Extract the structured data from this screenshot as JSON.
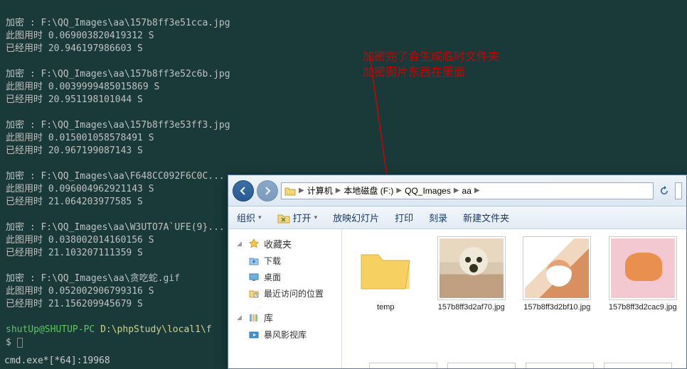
{
  "terminal": {
    "blocks": [
      {
        "encrypt": "加密 : F:\\QQ_Images\\aa\\157b8ff3e51cca.jpg",
        "img_time": "此图用时 0.069003820419312 S",
        "elapsed": "已经用时 20.946197986603 S"
      },
      {
        "encrypt": "加密 : F:\\QQ_Images\\aa\\157b8ff3e52c6b.jpg",
        "img_time": "此图用时 0.0039999485015869 S",
        "elapsed": "已经用时 20.951198101044 S"
      },
      {
        "encrypt": "加密 : F:\\QQ_Images\\aa\\157b8ff3e53ff3.jpg",
        "img_time": "此图用时 0.015001058578491 S",
        "elapsed": "已经用时 20.967199087143 S"
      },
      {
        "encrypt": "加密 : F:\\QQ_Images\\aa\\F648CC092F6C0C...",
        "img_time": "此图用时 0.096004962921143 S",
        "elapsed": "已经用时 21.064203977585 S"
      },
      {
        "encrypt": "加密 : F:\\QQ_Images\\aa\\W3UTO7A`UFE(9}...",
        "img_time": "此图用时 0.038002014160156 S",
        "elapsed": "已经用时 21.103207111359 S"
      },
      {
        "encrypt": "加密 : F:\\QQ_Images\\aa\\贪吃蛇.gif",
        "img_time": "此图用时 0.052002906799316 S",
        "elapsed": "已经用时 21.156209945679 S"
      }
    ],
    "prompt_user": "shutUp@SHUTUP-PC",
    "prompt_path": "D:\\phpStudy\\local1\\f",
    "prompt_dollar": "$ ",
    "status_line": "cmd.exe*[*64]:19968"
  },
  "annotation": {
    "line1": "加密完了会生成临时文件夹",
    "line2": "加密图片东西在里面"
  },
  "explorer": {
    "breadcrumb": {
      "seg1": "计算机",
      "seg2": "本地磁盘 (F:)",
      "seg3": "QQ_Images",
      "seg4": "aa"
    },
    "toolbar": {
      "organize": "组织",
      "open": "打开",
      "slideshow": "放映幻灯片",
      "print": "打印",
      "burn": "刻录",
      "newfolder": "新建文件夹"
    },
    "sidebar": {
      "favorites": "收藏夹",
      "downloads": "下载",
      "desktop": "桌面",
      "recent": "最近访问的位置",
      "library": "库",
      "bfvideo": "暴风影视库"
    },
    "items": [
      {
        "type": "folder",
        "label": "temp"
      },
      {
        "type": "image",
        "label": "157b8ff3d2af70.jpg",
        "thumb": "dog"
      },
      {
        "type": "image",
        "label": "157b8ff3d2bf10.jpg",
        "thumb": "cat1"
      },
      {
        "type": "image",
        "label": "157b8ff3d2cac9.jpg",
        "thumb": "cat2"
      }
    ]
  }
}
